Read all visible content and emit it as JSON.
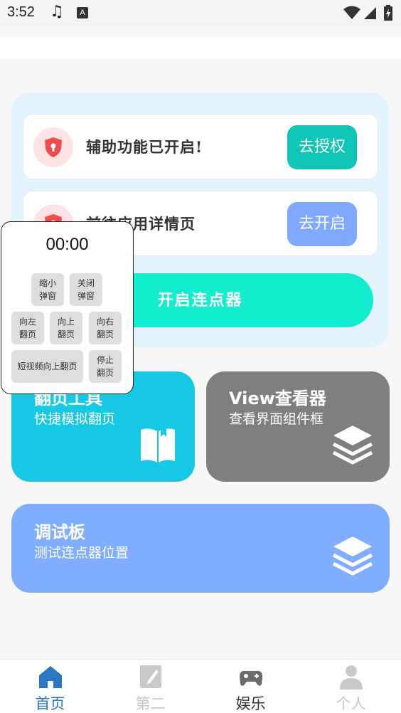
{
  "status_bar": {
    "time": "3:52",
    "a_badge": "A"
  },
  "permissions": {
    "accessibility": {
      "label": "辅助功能已开启!",
      "button": "去授权"
    },
    "app_details": {
      "label": "前往应用详情页",
      "button": "去开启"
    }
  },
  "start_button": {
    "label": "开启连点器"
  },
  "float_window": {
    "timer": "00:00",
    "buttons": {
      "shrink": "缩小\n弹窗",
      "close": "关闭\n弹窗",
      "flip_left": "向左\n翻页",
      "flip_up": "向上\n翻页",
      "flip_right": "向右\n翻页",
      "short_video_up": "短视频向上翻页",
      "stop": "停止\n翻页"
    }
  },
  "tiles": {
    "page_flip": {
      "title": "翻页工具",
      "subtitle": "快捷模拟翻页"
    },
    "view_viewer": {
      "title": "View查看器",
      "subtitle": "查看界面组件框"
    },
    "debug_board": {
      "title": "调试板",
      "subtitle": "测试连点器位置"
    }
  },
  "bottom_nav": [
    {
      "label": "首页",
      "icon": "home-icon",
      "active": true
    },
    {
      "label": "第二",
      "icon": "edit-note-icon",
      "active": false
    },
    {
      "label": "娱乐",
      "icon": "gamepad-icon",
      "active": false
    },
    {
      "label": "个人",
      "icon": "person-icon",
      "active": false
    }
  ],
  "colors": {
    "accent_teal": "#0fc5b5",
    "accent_blue": "#7fa9ff",
    "start_button": "#12eccf",
    "nav_active": "#2a78c4",
    "nav_inactive": "#c9c9c9",
    "nav_entertainment": "#6b6b6b"
  }
}
